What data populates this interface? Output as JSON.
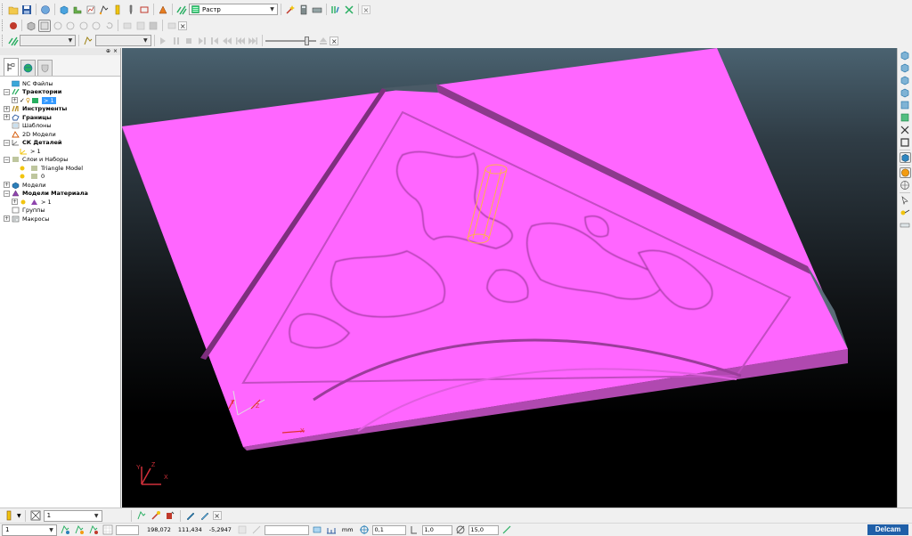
{
  "toolbar1": {
    "strategy_combo_value": "Растр"
  },
  "toolbar2": {
    "close_label": "×"
  },
  "toolbar3": {
    "close_label": "×"
  },
  "panel": {
    "pin_label": "⊕",
    "close_label": "×"
  },
  "tree": {
    "items": [
      {
        "label": "NC Файлы",
        "bold": false
      },
      {
        "label": "Траектории",
        "bold": true
      },
      {
        "label": "> 1",
        "bold": false,
        "selected": true
      },
      {
        "label": "Инструменты",
        "bold": true
      },
      {
        "label": "Границы",
        "bold": true
      },
      {
        "label": "Шаблоны",
        "bold": false
      },
      {
        "label": "2D Модели",
        "bold": false
      },
      {
        "label": "СК Деталей",
        "bold": true
      },
      {
        "label": "> 1",
        "bold": false
      },
      {
        "label": "Слои и Наборы",
        "bold": false
      },
      {
        "label": "Triangle Model",
        "bold": false
      },
      {
        "label": "0",
        "bold": false
      },
      {
        "label": "Модели",
        "bold": false
      },
      {
        "label": "Модели Материала",
        "bold": true
      },
      {
        "label": "> 1",
        "bold": false
      },
      {
        "label": "Группы",
        "bold": false
      },
      {
        "label": "Макросы",
        "bold": false
      }
    ]
  },
  "viewport": {
    "axis_labels": {
      "x": "X",
      "y": "Y",
      "z": "Z"
    },
    "model_color": "#ff66ff",
    "model_side_color": "#c24dc2",
    "tool_color": "#ffb347"
  },
  "bottom1": {
    "layer_value": "1",
    "close_label": "×"
  },
  "bottom2": {
    "workplane_value": "1",
    "coord_x": "198,072",
    "coord_y": "111,434",
    "coord_z": "-5,2947",
    "units": "mm",
    "tolerance": "0,1",
    "stepover": "1,0",
    "angle": "15,0"
  },
  "brand": {
    "logo_text": "Delcam"
  }
}
